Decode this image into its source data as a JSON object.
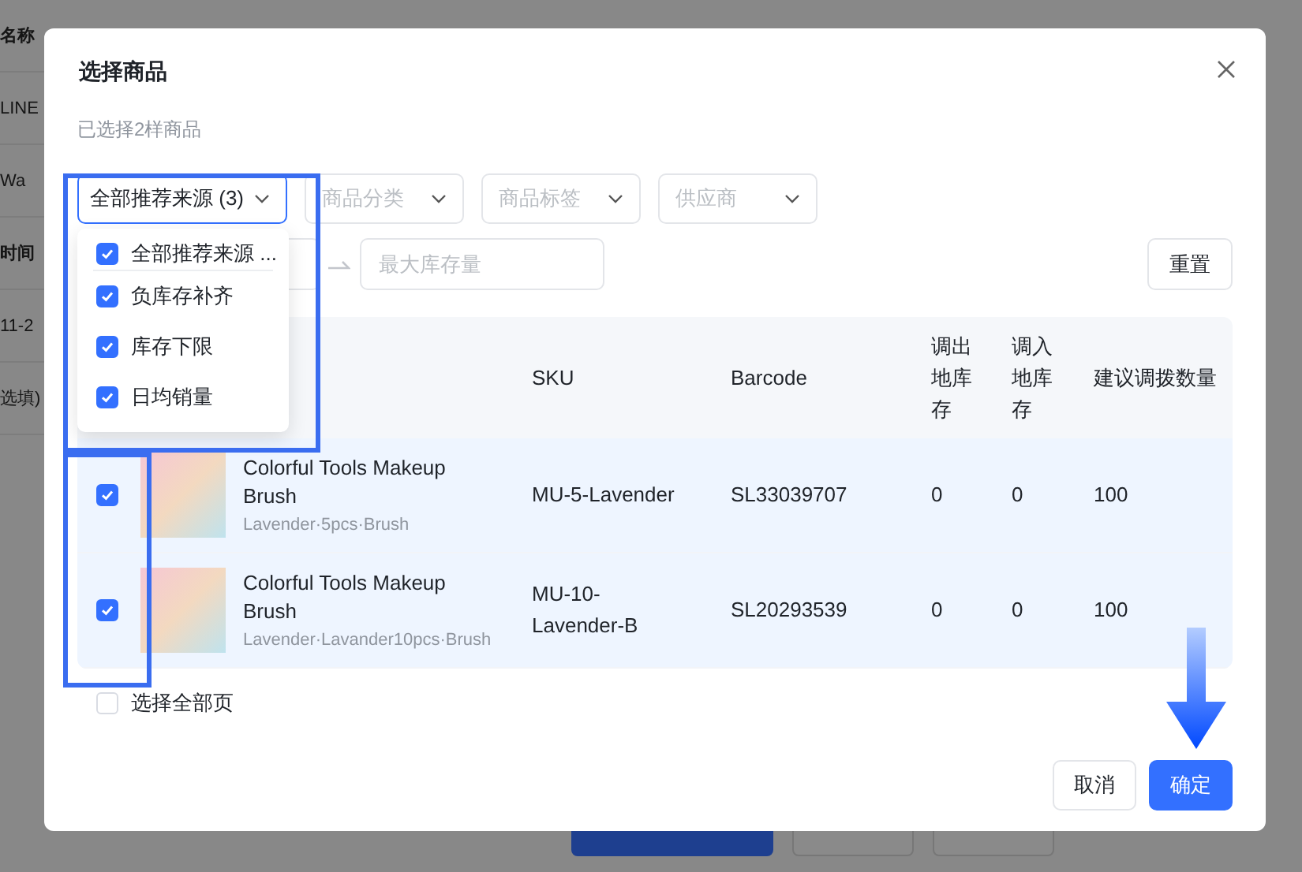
{
  "background_page": {
    "texts": [
      "名称",
      "LINE",
      "Wa",
      "时间",
      "11-2",
      "选填)"
    ]
  },
  "dialog": {
    "title": "选择商品",
    "selected_count": "已选择2样商品",
    "filters": [
      {
        "value": "全部推荐来源 (3)",
        "expanded": true,
        "options": [
          {
            "label": "全部推荐来源 ...",
            "checked": true,
            "kind": "all"
          },
          {
            "label": "负库存补齐",
            "checked": true,
            "kind": "option"
          },
          {
            "label": "库存下限",
            "checked": true,
            "kind": "option"
          },
          {
            "label": "日均销量",
            "checked": true,
            "kind": "option"
          }
        ]
      },
      {
        "placeholder": "商品分类",
        "expanded": false
      },
      {
        "placeholder": "商品标签",
        "expanded": false
      },
      {
        "placeholder": "供应商",
        "expanded": false
      }
    ],
    "stock_range": {
      "max_placeholder": "最大库存量"
    },
    "reset_button": "重置",
    "table": {
      "columns": [
        "SKU",
        "Barcode",
        "调出地库存",
        "调入地库存",
        "建议调拨数量"
      ],
      "rows": [
        {
          "selected": true,
          "name": "Colorful Tools Makeup Brush",
          "variant": "Lavender·5pcs·Brush",
          "sku": "MU-5-Lavender",
          "barcode": "SL33039707",
          "out_stock": "0",
          "in_stock": "0",
          "suggested_qty": "100"
        },
        {
          "selected": true,
          "name": "Colorful Tools Makeup Brush",
          "variant": "Lavender·Lavander10pcs·Brush",
          "sku": "MU-10-Lavender-B",
          "barcode": "SL20293539",
          "out_stock": "0",
          "in_stock": "0",
          "suggested_qty": "100"
        }
      ]
    },
    "select_all_pages": {
      "label": "选择全部页",
      "checked": false
    },
    "buttons": [
      {
        "label": "取消",
        "kind": "default"
      },
      {
        "label": "确定",
        "kind": "primary"
      }
    ]
  },
  "annotations": [
    {
      "kind": "highlight"
    },
    {
      "kind": "highlight"
    },
    {
      "kind": "arrow"
    }
  ]
}
